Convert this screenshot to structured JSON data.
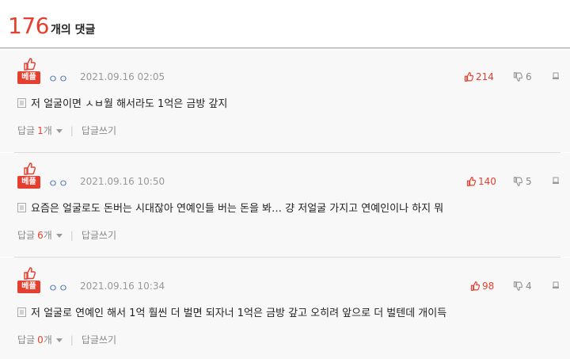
{
  "header": {
    "count": "176",
    "suffix": "개의 댓글"
  },
  "best_label": "베플",
  "reply_label": "답글",
  "reply_count_suffix": "개",
  "write_reply_label": "답글쓰기",
  "colors": {
    "accent": "#e5402f",
    "nick": "#4a73b8",
    "muted": "#999999"
  },
  "comments": [
    {
      "nick": "ㅇㅇ",
      "date": "2021.09.16 02:05",
      "likes": "214",
      "dislikes": "6",
      "text": "저 얼굴이면 ㅅㅂ월 해서라도 1억은 금방 갚지",
      "replies": "1"
    },
    {
      "nick": "ㅇㅇ",
      "date": "2021.09.16 10:50",
      "likes": "140",
      "dislikes": "5",
      "text": "요즘은 얼굴로도 돈버는 시대잖아 연예인들 버는 돈을 봐… 걍 저얼굴 가지고 연예인이나 하지 뭐",
      "replies": "6"
    },
    {
      "nick": "ㅇㅇ",
      "date": "2021.09.16 10:34",
      "likes": "98",
      "dislikes": "4",
      "text": "저 얼굴로 연예인 해서 1억 훨씬 더 벌면 되자너 1억은 금방 갚고 오히려 앞으로 더 벌텐데 개이득",
      "replies": "0"
    }
  ]
}
